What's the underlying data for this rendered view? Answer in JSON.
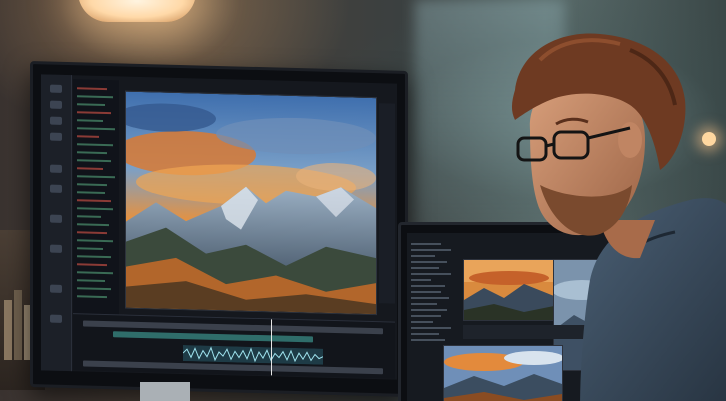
{
  "scene": {
    "description_colors": {
      "wall_warm": "#4a4038",
      "wall_cool": "#5b6d6c",
      "sky_orange": "#e8843a",
      "sky_blue": "#4f7fb6",
      "mountain_dark": "#2b3a4a",
      "forest_autumn": "#b0642a",
      "shirt_denim": "#3c4c5e",
      "hair_auburn": "#6e3a22"
    }
  }
}
